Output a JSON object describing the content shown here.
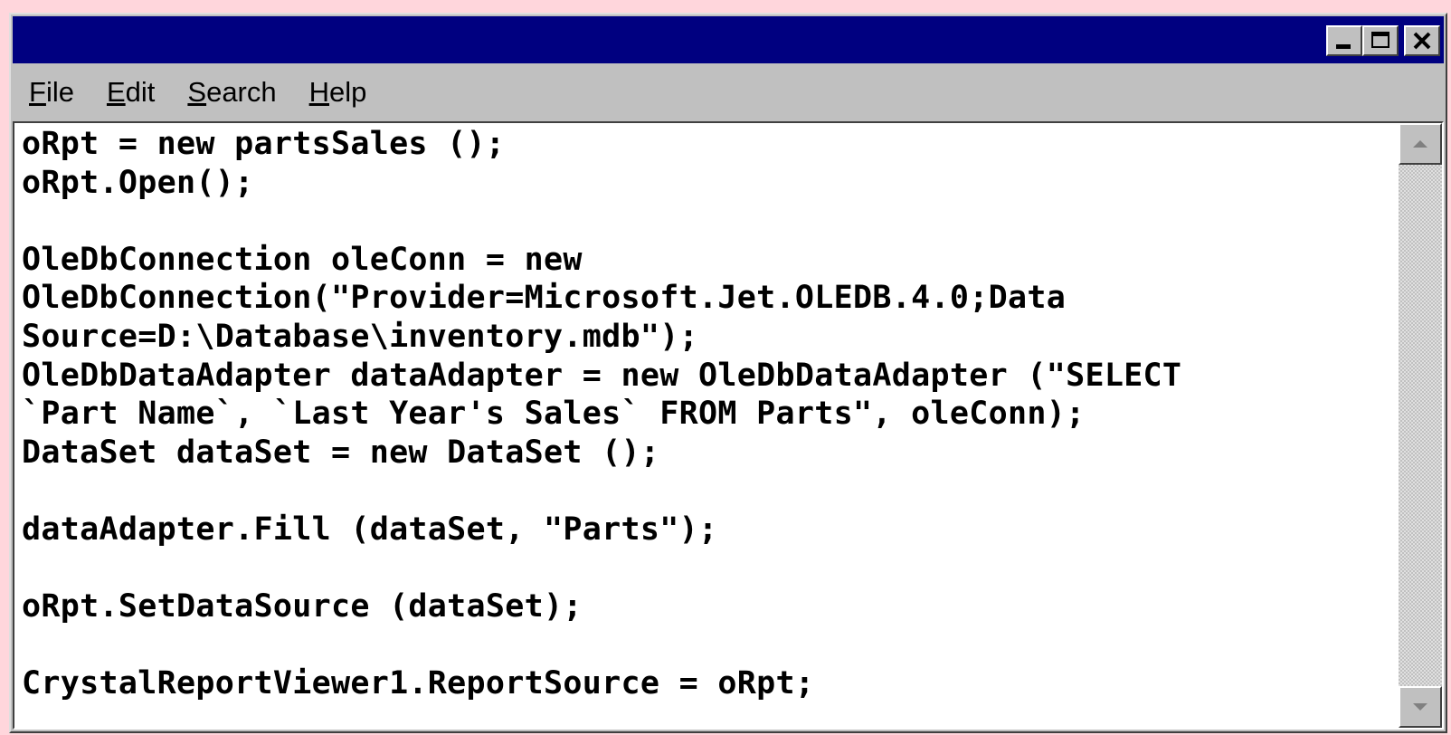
{
  "window": {
    "title": "",
    "controls": {
      "minimize_icon": "minimize-icon",
      "maximize_icon": "maximize-icon",
      "close_icon": "close-icon"
    },
    "colors": {
      "titlebar": "#000080",
      "chrome": "#c0c0c0",
      "background": "#ffd6dc"
    }
  },
  "menu": {
    "items": [
      {
        "label": "File"
      },
      {
        "label": "Edit"
      },
      {
        "label": "Search"
      },
      {
        "label": "Help"
      }
    ]
  },
  "editor": {
    "lines": [
      "oRpt = new partsSales ();",
      "oRpt.Open();",
      "",
      "OleDbConnection oleConn = new",
      "OleDbConnection(\"Provider=Microsoft.Jet.OLEDB.4.0;Data",
      "Source=D:\\Database\\inventory.mdb\");",
      "OleDbDataAdapter dataAdapter = new OleDbDataAdapter (\"SELECT",
      "`Part Name`, `Last Year's Sales` FROM Parts\", oleConn);",
      "DataSet dataSet = new DataSet ();",
      "",
      "dataAdapter.Fill (dataSet, \"Parts\");",
      "",
      "oRpt.SetDataSource (dataSet);",
      "",
      "CrystalReportViewer1.ReportSource = oRpt;"
    ]
  },
  "scrollbar": {
    "up_icon": "scroll-up-arrow-icon",
    "down_icon": "scroll-down-arrow-icon"
  }
}
